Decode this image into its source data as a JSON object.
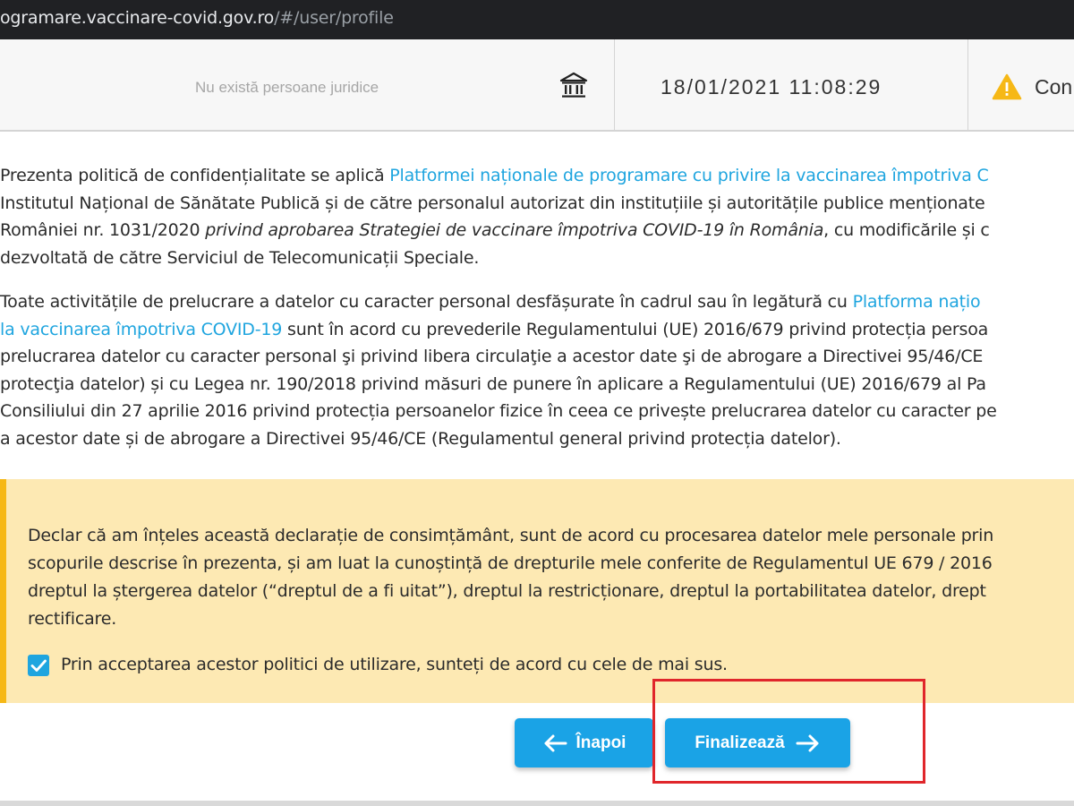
{
  "browser": {
    "url_host": "ogramare.vaccinare-covid.gov.ro",
    "url_path": "/#/user/profile"
  },
  "header": {
    "legal_entities_text": "Nu există persoane juridice",
    "bank_icon": "institution-icon",
    "datetime": "18/01/2021 11:08:29",
    "warning_icon": "warning-triangle-icon",
    "status_text": "Con"
  },
  "policy": {
    "p1": {
      "l1_text": "Prezenta politică de confidențialitate se aplică ",
      "l1_link": "Platformei naționale de programare cu privire la vaccinarea împotriva C",
      "l2": "Institutul Național de Sănătate Publică și de către personalul autorizat din instituțiile și autoritățile publice menționate",
      "l3_a": "României nr. 1031/2020 ",
      "l3_b": "privind aprobarea Strategiei de vaccinare împotriva COVID-19 în România",
      "l3_c": ", cu modificările și c",
      "l4": "dezvoltată de către Serviciul de Telecomunicații Speciale."
    },
    "p2": {
      "l1_text": "Toate activitățile de prelucrare a datelor cu caracter personal desfășurate în cadrul sau în legătură cu ",
      "l1_link": "Platforma națio",
      "l2_link": "la vaccinarea împotriva COVID-19",
      "l2_text": " sunt în acord cu prevederile Regulamentului (UE) 2016/679 privind protecția persoa",
      "l3": "prelucrarea datelor cu caracter personal şi privind libera circulaţie a acestor date şi de abrogare a Directivei 95/46/CE",
      "l4": "protecţia datelor) și cu Legea nr. 190/2018 privind măsuri de punere în aplicare a Regulamentului (UE) 2016/679 al Pa",
      "l5": "Consiliului din 27 aprilie 2016 privind protecția persoanelor fizice în ceea ce privește prelucrarea datelor cu caracter pe",
      "l6": "a acestor date și de abrogare a Directivei 95/46/CE (Regulamentul general privind protecția datelor)."
    }
  },
  "consent": {
    "lines": [
      "Declar că am înțeles această declarație de consimțământ, sunt de acord cu procesarea datelor mele personale prin",
      "scopurile descrise în prezenta, și am luat la cunoștință de drepturile mele conferite de Regulamentul UE 679 / 2016",
      "dreptul la ștergerea datelor (“dreptul de a fi uitat”), dreptul la restricționare, dreptul la portabilitatea datelor, drept",
      "rectificare."
    ],
    "checkbox_checked": true,
    "checkbox_label": "Prin acceptarea acestor politici de utilizare, sunteți de acord cu cele de mai sus."
  },
  "buttons": {
    "back_label": "Înapoi",
    "back_icon": "arrow-left-icon",
    "finish_label": "Finalizează",
    "finish_icon": "arrow-right-icon"
  },
  "colors": {
    "accent": "#1aa3e6",
    "link": "#1fa5df",
    "consent_bg": "#fde9b3",
    "consent_border": "#f6b816",
    "highlight": "#e0262b",
    "warning": "#f6b816"
  }
}
